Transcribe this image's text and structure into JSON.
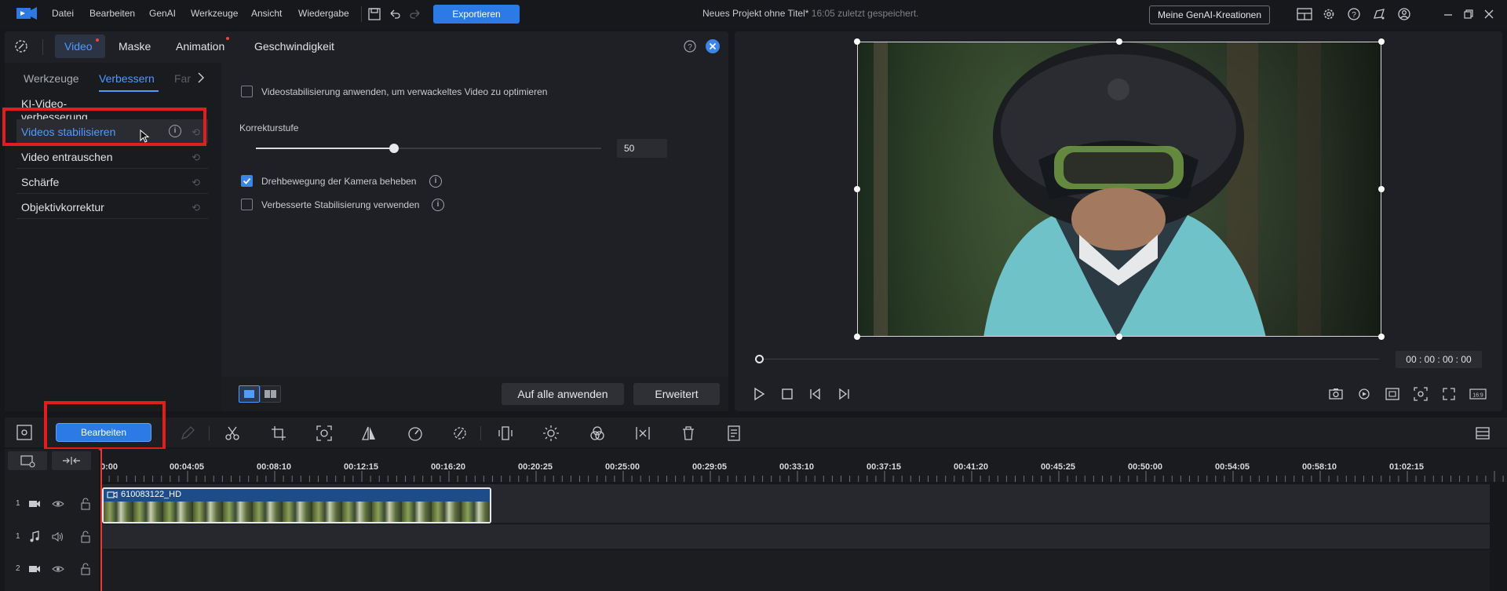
{
  "menu": [
    "Datei",
    "Bearbeiten",
    "GenAI",
    "Werkzeuge",
    "Ansicht",
    "Wiedergabe"
  ],
  "export_label": "Exportieren",
  "project": {
    "title": "Neues Projekt ohne Titel*",
    "saved": "16:05 zuletzt gespeichert."
  },
  "genai_button": "Meine GenAI-Kreationen",
  "tabs": {
    "video": "Video",
    "mask": "Maske",
    "animation": "Animation",
    "speed": "Geschwindigkeit"
  },
  "subtabs": {
    "tools": "Werkzeuge",
    "improve": "Verbessern",
    "color": "Far"
  },
  "sidebar": {
    "items": [
      {
        "label": "KI-Video-verbesserung"
      },
      {
        "label": "Videos stabilisieren"
      },
      {
        "label": "Video entrauschen"
      },
      {
        "label": "Schärfe"
      },
      {
        "label": "Objektivkorrektur"
      }
    ]
  },
  "settings": {
    "apply_stabilization": "Videostabilisierung anwenden, um verwackeltes Video zu optimieren",
    "correction_label": "Korrekturstufe",
    "correction_value": "50",
    "correction_level": 0.4,
    "fix_rotation": "Drehbewegung der Kamera beheben",
    "improved_stabilization": "Verbesserte Stabilisierung verwenden"
  },
  "buttons": {
    "apply_all": "Auf alle anwenden",
    "advanced": "Erweitert",
    "edit": "Bearbeiten"
  },
  "preview": {
    "timecode": "00 : 00 : 00 : 00"
  },
  "timeline": {
    "ruler": [
      "0:00",
      "00:04:05",
      "00:08:10",
      "00:12:15",
      "00:16:20",
      "00:20:25",
      "00:25:00",
      "00:29:05",
      "00:33:10",
      "00:37:15",
      "00:41:20",
      "00:45:25",
      "00:50:00",
      "00:54:05",
      "00:58:10",
      "01:02:15"
    ],
    "tracks": [
      {
        "num": "1",
        "type": "video"
      },
      {
        "num": "1",
        "type": "audio"
      },
      {
        "num": "2",
        "type": "video"
      }
    ],
    "clip_name": "610083122_HD"
  },
  "colors": {
    "accent": "#2b7ae6",
    "highlight": "#e01e1e"
  }
}
